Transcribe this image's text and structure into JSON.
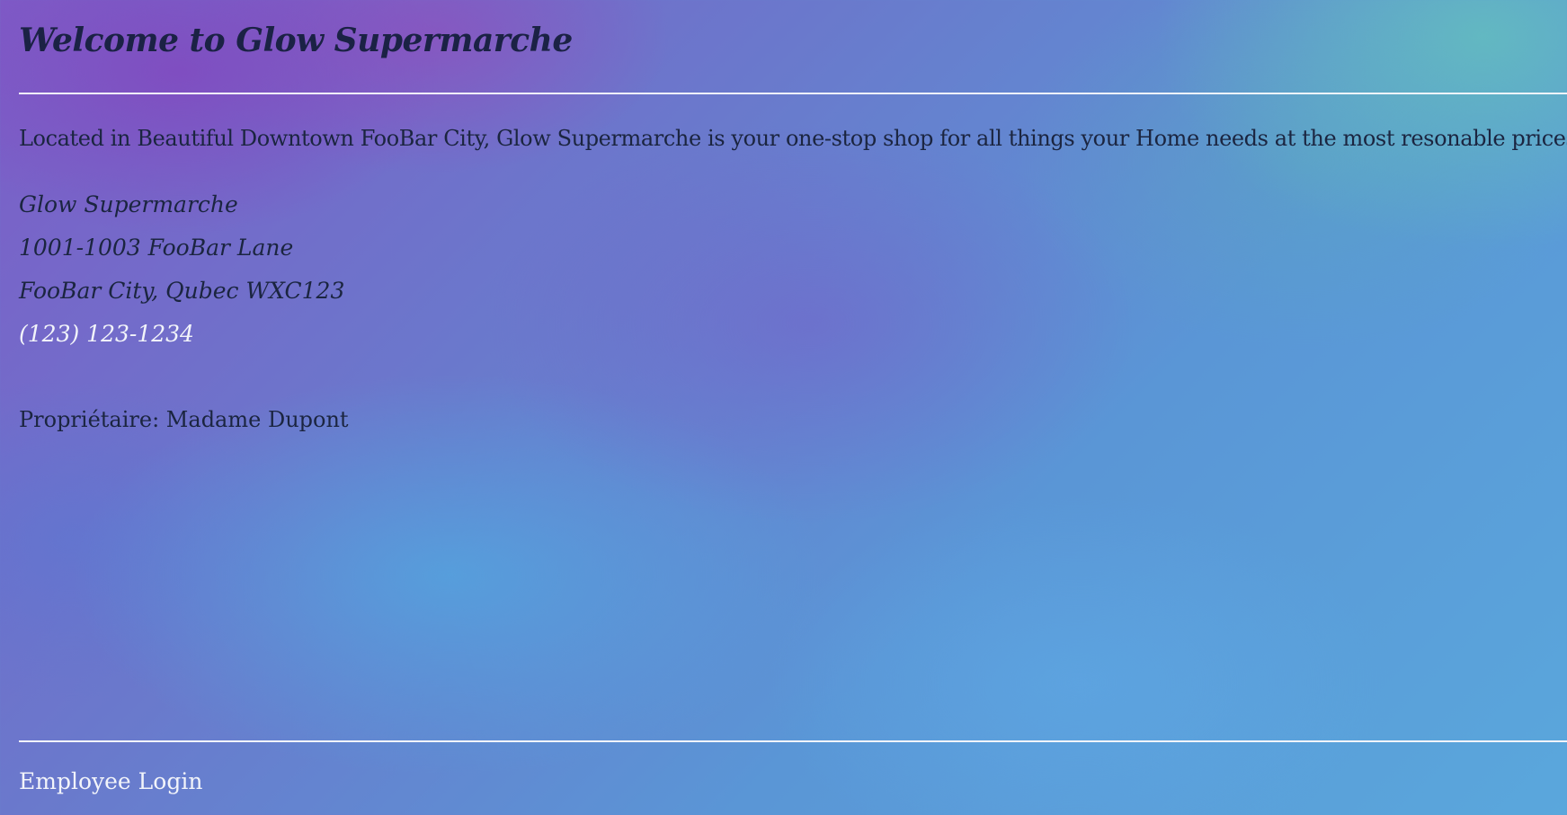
{
  "header": {
    "title": "Welcome to Glow Supermarche"
  },
  "main": {
    "intro": "Located in Beautiful Downtown FooBar City, Glow Supermarche is your one-stop shop for all things your Home needs at the most resonable prices!",
    "address": {
      "name": "Glow Supermarche",
      "street": "1001-1003 FooBar Lane",
      "city": "FooBar City, Qubec WXC123",
      "phone": "(123) 123-1234"
    },
    "owner": "Propriétaire: Madame Dupont"
  },
  "footer": {
    "employee_login_label": "Employee Login"
  },
  "colors": {
    "heading_text": "#1b2245",
    "body_text": "#1b2540",
    "light_text": "#f2f4fa",
    "rule": "#f2f4fa"
  }
}
